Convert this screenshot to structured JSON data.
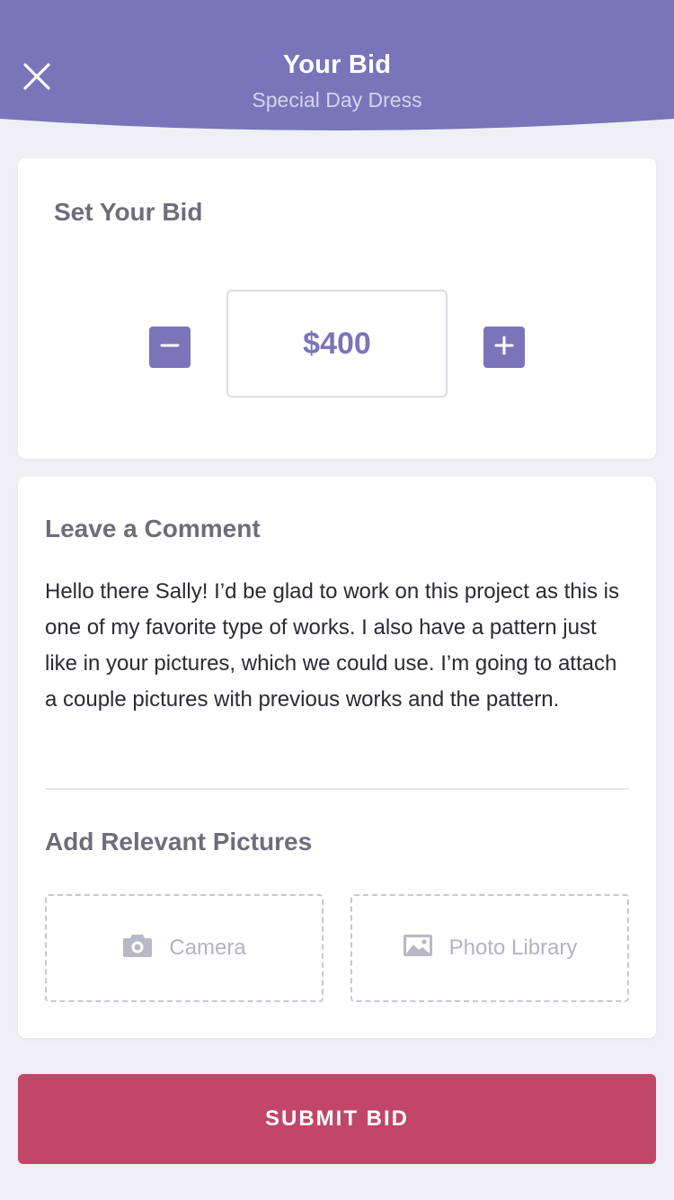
{
  "header": {
    "title": "Your Bid",
    "subtitle": "Special Day Dress",
    "close_icon": "close-icon"
  },
  "bid": {
    "title": "Set Your Bid",
    "amount": "$400",
    "minus_icon": "minus-icon",
    "plus_icon": "plus-icon"
  },
  "comment": {
    "title": "Leave a Comment",
    "text": "Hello there Sally! I’d be glad to work on this project as this is one of my favorite type of works. I also have a pattern just like in your pictures, which we could use. I’m going to attach a couple pictures with previous works and the pattern."
  },
  "pictures": {
    "title": "Add Relevant Pictures",
    "camera_label": "Camera",
    "camera_icon": "camera-icon",
    "library_label": "Photo Library",
    "library_icon": "image-icon"
  },
  "submit": {
    "label": "SUBMIT BID"
  },
  "colors": {
    "header": "#7875ba",
    "accent": "#7a75ba",
    "submit": "#c24667",
    "background": "#efeff4"
  }
}
